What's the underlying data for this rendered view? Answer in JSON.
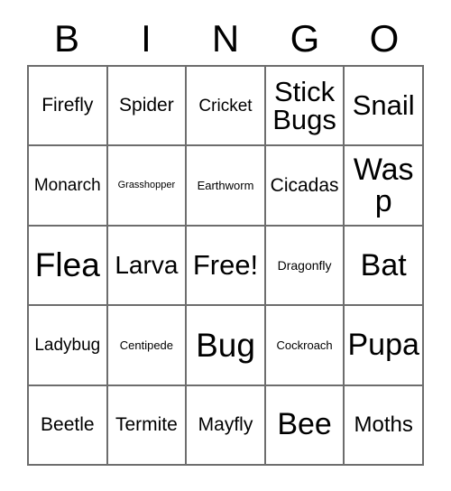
{
  "card": {
    "title": "Bingo Card",
    "header_letters": [
      "B",
      "I",
      "N",
      "G",
      "O"
    ],
    "free_space_label": "Free!",
    "colors": {
      "background": "#ffffff",
      "text": "#000000",
      "border": "#6d6d6d"
    },
    "grid": {
      "columns": 5,
      "rows": 5,
      "cells": [
        [
          {
            "label": "Firefly",
            "size": "fs-md2"
          },
          {
            "label": "Spider",
            "size": "fs-md2"
          },
          {
            "label": "Cricket",
            "size": "fs-md"
          },
          {
            "label": "Stick Bugs",
            "size": "fs-xxl"
          },
          {
            "label": "Snail",
            "size": "fs-xxl"
          }
        ],
        [
          {
            "label": "Monarch",
            "size": "fs-md"
          },
          {
            "label": "Grasshopper",
            "size": "fs-xs"
          },
          {
            "label": "Earthworm",
            "size": "fs-sm"
          },
          {
            "label": "Cicadas",
            "size": "fs-md2"
          },
          {
            "label": "Wasp",
            "size": "fs-huge"
          }
        ],
        [
          {
            "label": "Flea",
            "size": "fs-mega"
          },
          {
            "label": "Larva",
            "size": "fs-xl"
          },
          {
            "label": "Free!",
            "size": "fs-xxl"
          },
          {
            "label": "Dragonfly",
            "size": "fs-sm2"
          },
          {
            "label": "Bat",
            "size": "fs-huge"
          }
        ],
        [
          {
            "label": "Ladybug",
            "size": "fs-md"
          },
          {
            "label": "Centipede",
            "size": "fs-sm"
          },
          {
            "label": "Bug",
            "size": "fs-mega"
          },
          {
            "label": "Cockroach",
            "size": "fs-sm"
          },
          {
            "label": "Pupa",
            "size": "fs-huge"
          }
        ],
        [
          {
            "label": "Beetle",
            "size": "fs-md2"
          },
          {
            "label": "Termite",
            "size": "fs-md2"
          },
          {
            "label": "Mayfly",
            "size": "fs-md2"
          },
          {
            "label": "Bee",
            "size": "fs-huge"
          },
          {
            "label": "Moths",
            "size": "fs-lg"
          }
        ]
      ]
    }
  }
}
